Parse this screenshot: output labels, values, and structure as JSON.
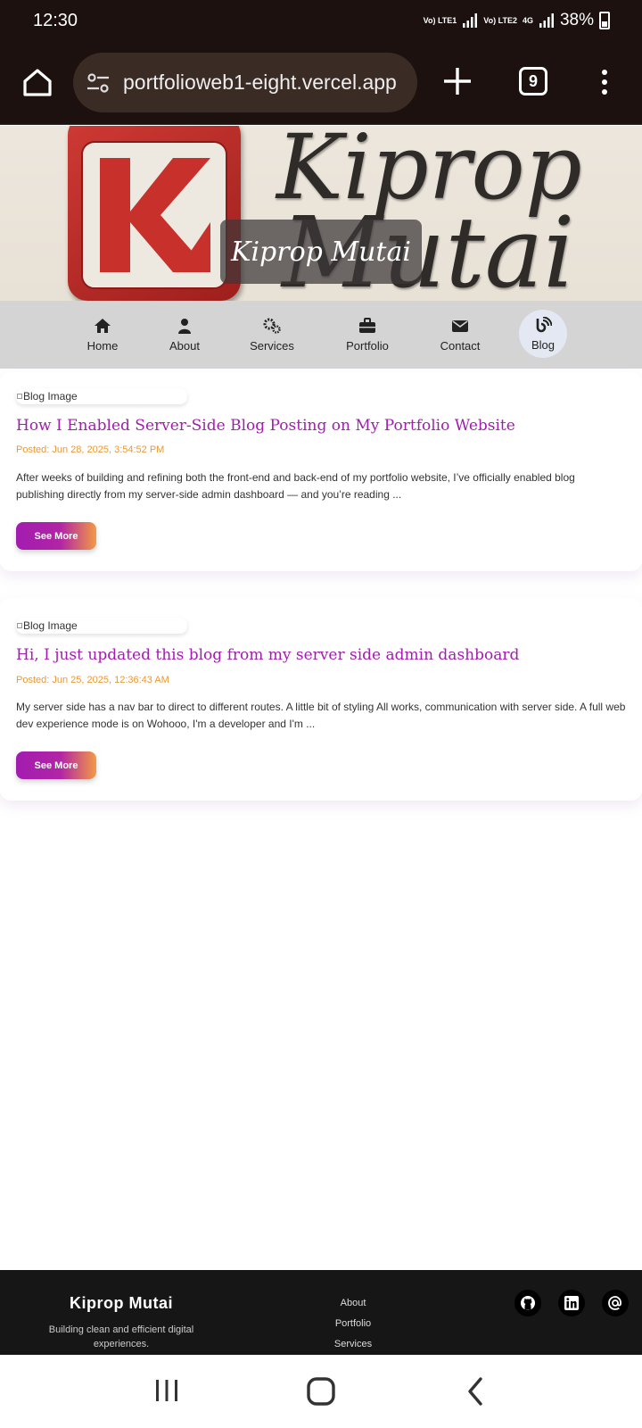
{
  "status_bar": {
    "time": "12:30",
    "sim1": "Vo) LTE1",
    "sim2": "Vo) LTE2",
    "network": "4G",
    "battery": "38%"
  },
  "browser": {
    "url": "portfolioweb1-eight.vercel.app",
    "tab_count": "9"
  },
  "hero": {
    "logo_letters": "KM",
    "first_name": "Kiprop",
    "last_name": "Mutai",
    "overlay_title": "Kiprop Mutai"
  },
  "nav": {
    "items": [
      {
        "label": "Home",
        "icon": "home-icon"
      },
      {
        "label": "About",
        "icon": "user-icon"
      },
      {
        "label": "Services",
        "icon": "gears-icon"
      },
      {
        "label": "Portfolio",
        "icon": "briefcase-icon"
      },
      {
        "label": "Contact",
        "icon": "envelope-icon"
      },
      {
        "label": "Blog",
        "icon": "blog-icon"
      }
    ],
    "active": "Blog"
  },
  "posts": [
    {
      "image_alt": "Blog Image",
      "title": "How I Enabled Server-Side Blog Posting on My Portfolio Website",
      "date": "Posted: Jun 28, 2025, 3:54:52 PM",
      "excerpt": "After weeks of building and refining both the front-end and back-end of my portfolio website, I’ve officially enabled blog publishing directly from my server-side admin dashboard — and you’re reading ...",
      "button": "See More"
    },
    {
      "image_alt": "Blog Image",
      "title": "Hi, I just updated this blog from my server side admin dashboard",
      "date": "Posted: Jun 25, 2025, 12:36:43 AM",
      "excerpt": "My server side has a nav bar to direct to different routes. A little bit of styling All works, communication with server side. A full web dev experience mode is on Wohooo, I'm a developer and I'm ...",
      "button": "See More"
    }
  ],
  "footer": {
    "brand": "Kiprop Mutai",
    "tagline": "Building clean and efficient digital experiences.",
    "links": [
      "About",
      "Portfolio",
      "Services"
    ],
    "social_icons": [
      "github-icon",
      "linkedin-icon",
      "email-at-icon"
    ]
  },
  "colors": {
    "browser_bg": "#1c110e",
    "nav_bg": "#d4d4d4",
    "post_title": "#a21caf",
    "post_date": "#e99936",
    "footer_bg": "#161616",
    "button_gradient_start": "#a21caf",
    "button_gradient_end": "#f29a46"
  }
}
